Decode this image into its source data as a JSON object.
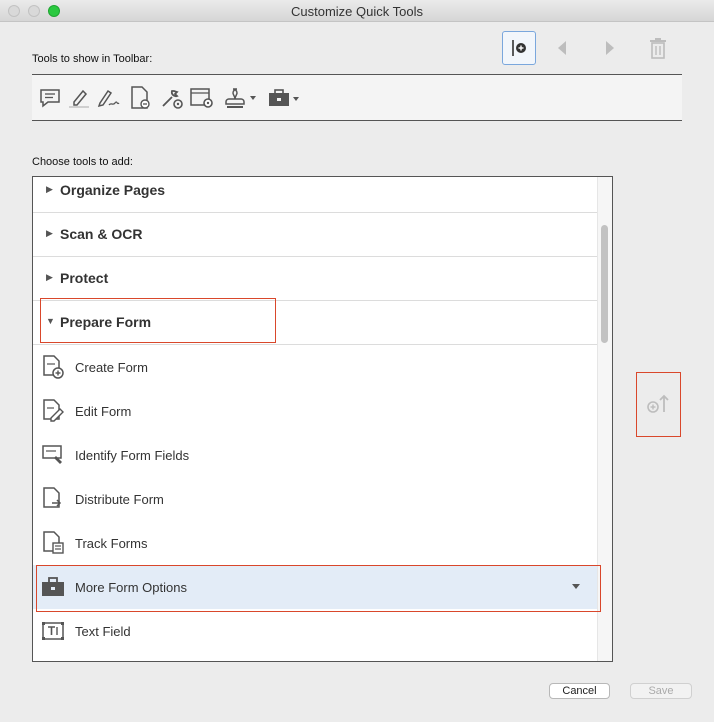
{
  "window": {
    "title": "Customize Quick Tools"
  },
  "toolbar_section": {
    "label": "Tools to show in Toolbar:",
    "icons": [
      "comment-icon",
      "highlight-icon",
      "fill-sign-icon",
      "export-pdf-icon",
      "tools-wrench-icon",
      "form-settings-icon",
      "stamp-icon",
      "more-tools-icon"
    ]
  },
  "top_actions": [
    "add-divider-icon",
    "move-left-icon",
    "move-right-icon",
    "trash-icon"
  ],
  "choose_section": {
    "label": "Choose tools to add:",
    "categories": [
      {
        "name": "Organize Pages"
      },
      {
        "name": "Scan & OCR"
      },
      {
        "name": "Protect"
      },
      {
        "name": "Prepare Form"
      }
    ],
    "tools": [
      {
        "name": "Create Form"
      },
      {
        "name": "Edit Form"
      },
      {
        "name": "Identify Form Fields"
      },
      {
        "name": "Distribute Form"
      },
      {
        "name": "Track Forms"
      },
      {
        "name": "More Form Options"
      },
      {
        "name": "Text Field"
      }
    ]
  },
  "buttons": {
    "cancel": "Cancel",
    "save": "Save"
  },
  "colors": {
    "accent": "#6fa0e0",
    "highlight_row": "#e3ecf7",
    "callout": "#d9472b"
  }
}
